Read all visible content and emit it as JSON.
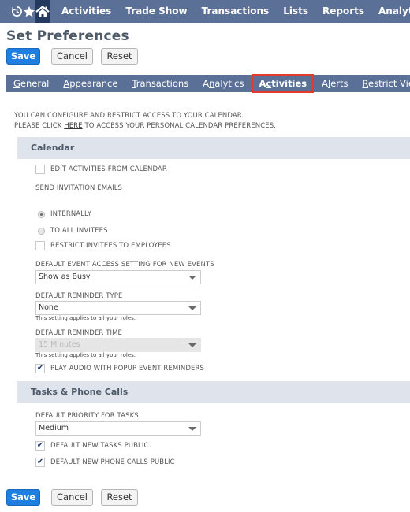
{
  "topnav": {
    "icons": [
      "recent-icon",
      "star-icon",
      "home-icon"
    ],
    "items": [
      "Activities",
      "Trade Show",
      "Transactions",
      "Lists",
      "Reports",
      "Analytics"
    ]
  },
  "page": {
    "title": "Set Preferences"
  },
  "buttons": {
    "save": "Save",
    "cancel": "Cancel",
    "reset": "Reset"
  },
  "subtabs": {
    "items": [
      {
        "label": "General",
        "underline_index": 0
      },
      {
        "label": "Appearance",
        "underline_index": 0
      },
      {
        "label": "Transactions",
        "underline_index": 0
      },
      {
        "label": "Analytics",
        "underline_index": 1
      },
      {
        "label": "Activities",
        "underline_index": 1
      },
      {
        "label": "Alerts",
        "underline_index": 1
      },
      {
        "label": "Restrict View",
        "underline_index": 0
      }
    ],
    "active": "Activities",
    "highlight_color": "#e23b2e"
  },
  "intro": {
    "line1": "YOU CAN CONFIGURE AND RESTRICT ACCESS TO YOUR CALENDAR.",
    "line2_prefix": "PLEASE CLICK ",
    "line2_link": "HERE",
    "line2_suffix": " TO ACCESS YOUR PERSONAL CALENDAR PREFERENCES."
  },
  "calendar": {
    "header": "Calendar",
    "edit_activities": {
      "label": "EDIT ACTIVITIES FROM CALENDAR",
      "checked": false
    },
    "send_invitation_label": "SEND INVITATION EMAILS",
    "radio_internally": {
      "label": "INTERNALLY",
      "selected": true
    },
    "radio_all_invitees": {
      "label": "TO ALL INVITEES",
      "selected": false
    },
    "restrict_invitees": {
      "label": "RESTRICT INVITEES TO EMPLOYEES",
      "checked": false
    },
    "event_access": {
      "label": "DEFAULT EVENT ACCESS SETTING FOR NEW EVENTS",
      "value": "Show as Busy"
    },
    "reminder_type": {
      "label": "DEFAULT REMINDER TYPE",
      "value": "None",
      "help": "This setting applies to all your roles."
    },
    "reminder_time": {
      "label": "DEFAULT REMINDER TIME",
      "value": "15 Minutes",
      "disabled": true,
      "help": "This setting applies to all your roles."
    },
    "play_audio": {
      "label": "PLAY AUDIO WITH POPUP EVENT REMINDERS",
      "checked": true
    }
  },
  "tasks": {
    "header": "Tasks & Phone Calls",
    "priority": {
      "label": "DEFAULT PRIORITY FOR TASKS",
      "value": "Medium"
    },
    "tasks_public": {
      "label": "DEFAULT NEW TASKS PUBLIC",
      "checked": true
    },
    "calls_public": {
      "label": "DEFAULT NEW PHONE CALLS PUBLIC",
      "checked": true
    }
  },
  "colors": {
    "nav_bg": "#5b7096",
    "home_bg": "#233a5e",
    "primary_button": "#1e7fe0",
    "section_bg": "#dfe4ec"
  }
}
